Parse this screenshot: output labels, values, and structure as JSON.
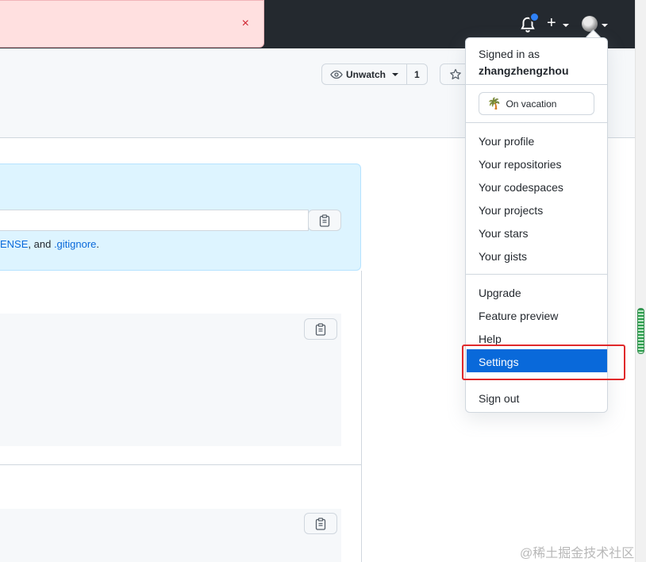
{
  "header": {
    "flash_close": "×",
    "plus": "+"
  },
  "repo": {
    "watch_label": "Unwatch",
    "watch_count": "1"
  },
  "quick_setup": {
    "hint_fragment": "ENSE",
    "hint_sep": ", and ",
    "hint_link": ".gitignore",
    "hint_end": "."
  },
  "menu": {
    "signed_in_prefix": "Signed in as",
    "username": "zhangzhengzhou",
    "status_emoji": "🌴",
    "status_text": "On vacation",
    "items": [
      "Your profile",
      "Your repositories",
      "Your codespaces",
      "Your projects",
      "Your stars",
      "Your gists"
    ],
    "items2": [
      "Upgrade",
      "Feature preview",
      "Help"
    ],
    "settings": "Settings",
    "sign_out": "Sign out"
  },
  "watermark": "@稀土掘金技术社区",
  "colors": {
    "header_bg": "#24292f",
    "accent": "#0969da",
    "highlight_box": "#e0292b",
    "flash_bg": "#ffe0e0"
  }
}
